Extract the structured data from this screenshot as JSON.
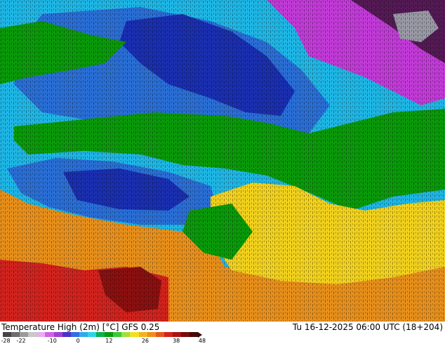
{
  "map": {
    "colors": {
      "darkred": "#8b1010",
      "red": "#d2231e",
      "orange": "#e8901c",
      "yellow": "#f2d21e",
      "green": "#0a9a0a",
      "darkgreen": "#0a6d2a",
      "cyan": "#1fb7e6",
      "blue": "#2a6fd6",
      "navy": "#1a2fb0",
      "magenta": "#c23bd8",
      "purple": "#7a2a8a",
      "darkpurple": "#551a55",
      "grey": "#9a9aa6"
    }
  },
  "footer": {
    "title": "Temperature High (2m) [°C] GFS 0.25",
    "datetime": "Tu 16-12-2025 06:00 UTC (18+204)",
    "scale_colors": [
      "#444444",
      "#6e6e6e",
      "#9a9a9a",
      "#c8c8c8",
      "#e6aef0",
      "#d062e6",
      "#a040d0",
      "#4a32c8",
      "#2f6fe0",
      "#34a9ec",
      "#2ad6e6",
      "#0ab052",
      "#0a9a0a",
      "#3cc83c",
      "#a0e03c",
      "#f2e020",
      "#f2b41e",
      "#ee8c1c",
      "#e4581c",
      "#d2231e",
      "#a81414",
      "#7a0c0c",
      "#4a0808"
    ],
    "ticks": [
      {
        "label": "-28",
        "v": -28
      },
      {
        "label": "-22",
        "v": -22
      },
      {
        "label": "-10",
        "v": -10
      },
      {
        "label": "0",
        "v": 0
      },
      {
        "label": "12",
        "v": 12
      },
      {
        "label": "26",
        "v": 26
      },
      {
        "label": "38",
        "v": 38
      },
      {
        "label": "48",
        "v": 48
      }
    ]
  }
}
